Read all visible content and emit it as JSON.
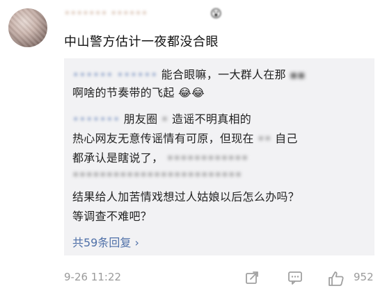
{
  "comment": {
    "username": "••••••• ••••••",
    "username_emoji": "😮",
    "text": "中山警方估计一夜都没合眼"
  },
  "reply": {
    "line1_name": "•••••• ••••••",
    "line1_text": "能合眼嘛，一大群人在那",
    "line1_tail": "▪▪",
    "line2_text": "啊啥的节奏带的飞起",
    "line2_emoji": "😂😂",
    "line3_name": "•••••••",
    "line3_text_a": "朋友圈",
    "line3_blur_a": "•",
    "line3_text_b": "造谣不明真相的",
    "line4_text": "热心网友无意传谣情有可原，但现在",
    "line4_blur": "••",
    "line4_tail": "自己",
    "line5_text": "都承认是瞎说了，",
    "line5_blur": "••••••••••••",
    "line6_blur": "•••••••••••••••••••••••••",
    "line7_text": "结果给人加苦情戏想过人姑娘以后怎么办吗？",
    "line8_text": "等调查不难吧？",
    "reply_count": "共59条回复 ›"
  },
  "footer": {
    "timestamp": "9-26 11:22",
    "like_count": "952"
  },
  "icons": {
    "share": "share-icon",
    "comment": "comment-icon",
    "like": "thumbs-up-icon"
  }
}
